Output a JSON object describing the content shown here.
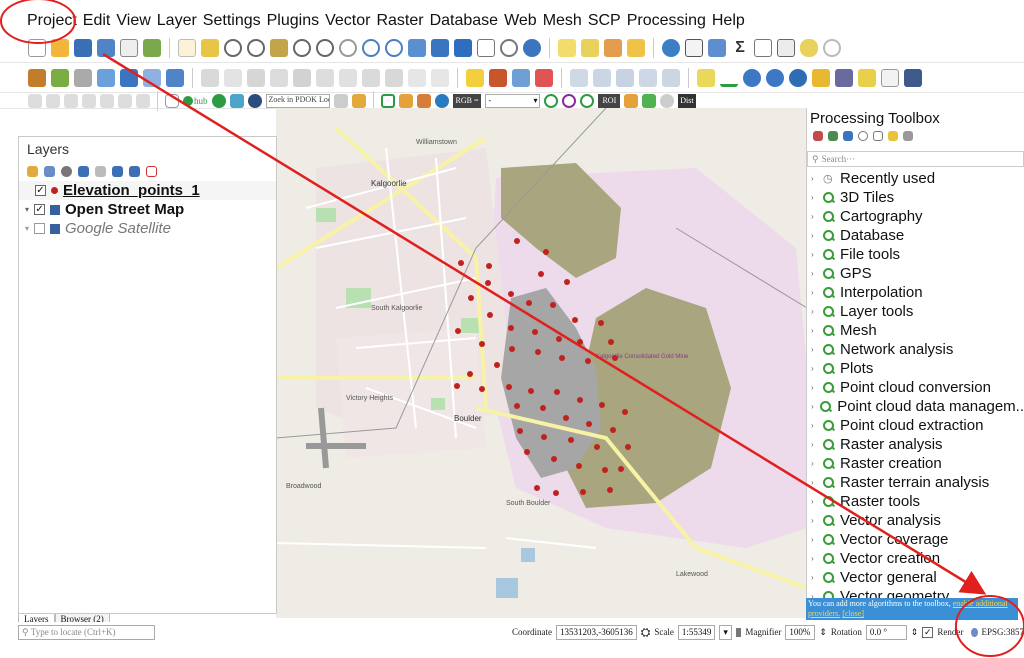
{
  "menu": [
    "Project",
    "Edit",
    "View",
    "Layer",
    "Settings",
    "Plugins",
    "Vector",
    "Raster",
    "Database",
    "Web",
    "Mesh",
    "SCP",
    "Processing",
    "Help"
  ],
  "toolbar3": {
    "pdok_placeholder": "Zoek in PDOK Loc···",
    "hub_label": "hub",
    "rgb_label": "RGB =",
    "rgb_value": "-",
    "roi_label": "ROI",
    "dist_label": "Dist"
  },
  "layers_panel": {
    "title": "Layers",
    "items": [
      {
        "label": "Elevation_points_1",
        "checked": true
      },
      {
        "label": "Open Street Map",
        "checked": true
      },
      {
        "label": "Google Satellite",
        "checked": false
      }
    ],
    "tabs": [
      "Layers",
      "Browser (2)"
    ]
  },
  "map_labels": {
    "kalgoorlie": "Kalgoorlie",
    "south_kalgoorlie": "South Kalgoorlie",
    "victory_heights": "Victory Heights",
    "boulder": "Boulder",
    "broadwood": "Broadwood",
    "south_boulder": "South Boulder",
    "lakewood": "Lakewood",
    "williamstown": "Williamstown",
    "consolidated": "Kalgoorlie Consolidated Gold Mine"
  },
  "toolbox": {
    "title": "Processing Toolbox",
    "search_placeholder": "Search···",
    "items": [
      "Recently used",
      "3D Tiles",
      "Cartography",
      "Database",
      "File tools",
      "GPS",
      "Interpolation",
      "Layer tools",
      "Mesh",
      "Network analysis",
      "Plots",
      "Point cloud conversion",
      "Point cloud data managem..",
      "Point cloud extraction",
      "Raster analysis",
      "Raster creation",
      "Raster terrain analysis",
      "Raster tools",
      "Vector analysis",
      "Vector coverage",
      "Vector creation",
      "Vector general",
      "Vector geometry"
    ],
    "info_text": "You can add more algorithms to the toolbox,",
    "info_link": "enable additional providers.",
    "info_close": "[close]"
  },
  "statusbar": {
    "locator_placeholder": "Type to locate (Ctrl+K)",
    "coordinate_label": "Coordinate",
    "coordinate_value": "13531203,-3605136",
    "scale_label": "Scale",
    "scale_value": "1:55349",
    "magnifier_label": "Magnifier",
    "magnifier_value": "100%",
    "rotation_label": "Rotation",
    "rotation_value": "0.0 °",
    "render_label": "Render",
    "epsg": "EPSG:3857"
  },
  "colors": {
    "annotation_red": "#e0201e",
    "point_red": "#c0221f",
    "mine_gray": "#a6a6a6",
    "mine_olive": "#a8a57f"
  }
}
